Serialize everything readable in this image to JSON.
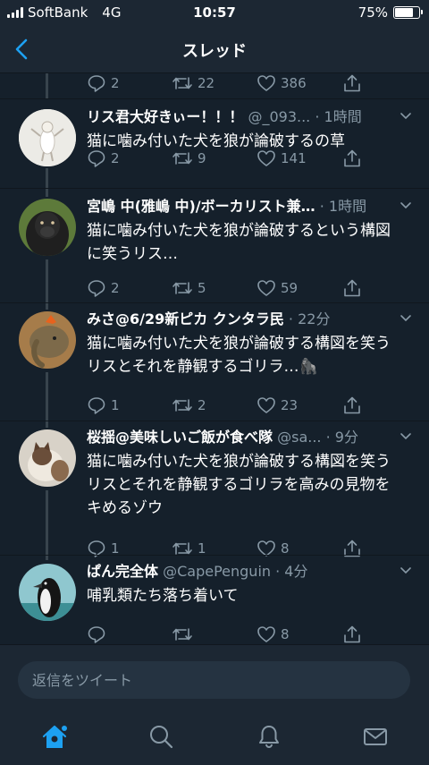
{
  "status_bar": {
    "carrier": "SoftBank",
    "network": "4G",
    "time": "10:57",
    "battery_text": "75%",
    "battery_level": 0.75
  },
  "header": {
    "title": "スレッド",
    "back_icon": "chevron-left-icon"
  },
  "top_actions": {
    "reply_count": "2",
    "retweet_count": "22",
    "like_count": "386"
  },
  "tweets": [
    {
      "name": "リス君大好きぃー！！！",
      "handle": "@_093...",
      "time": "· 1時間",
      "text": "猫に噛み付いた犬を狼が論破するの草",
      "reply_count": "2",
      "retweet_count": "9",
      "like_count": "141"
    },
    {
      "name": "宮嶋 中(雅嶋 中)/ボーカリスト兼…",
      "handle": "",
      "time": "· 1時間",
      "text": "猫に噛み付いた犬を狼が論破するという構図に笑うリス…",
      "reply_count": "2",
      "retweet_count": "5",
      "like_count": "59"
    },
    {
      "name": "みさ@6/29新ピカ クンタラ民",
      "handle": "",
      "time": "· 22分",
      "text": "猫に噛み付いた犬を狼が論破する構図を笑うリスとそれを静観するゴリラ…🦍",
      "reply_count": "1",
      "retweet_count": "2",
      "like_count": "23"
    },
    {
      "name": "桜揺@美味しいご飯が食べ隊",
      "handle": "@sa...",
      "time": "· 9分",
      "text": "猫に噛み付いた犬を狼が論破する構図を笑うリスとそれを静観するゴリラを高みの見物をキめるゾウ",
      "reply_count": "1",
      "retweet_count": "1",
      "like_count": "8"
    },
    {
      "name": "ぱん完全体",
      "handle": "@CapePenguin",
      "time": "· 4分",
      "text": "哺乳類たち落ち着いて",
      "reply_count": "",
      "retweet_count": "",
      "like_count": "8"
    }
  ],
  "reply_bar": {
    "placeholder": "返信をツイート"
  },
  "tab_bar": {
    "items": [
      "home-icon",
      "search-icon",
      "notifications-icon",
      "messages-icon"
    ],
    "active": "home-icon"
  },
  "colors": {
    "background": "#15202b",
    "bar": "#1c2733",
    "accent": "#1da1f2",
    "muted": "#8899a6"
  }
}
